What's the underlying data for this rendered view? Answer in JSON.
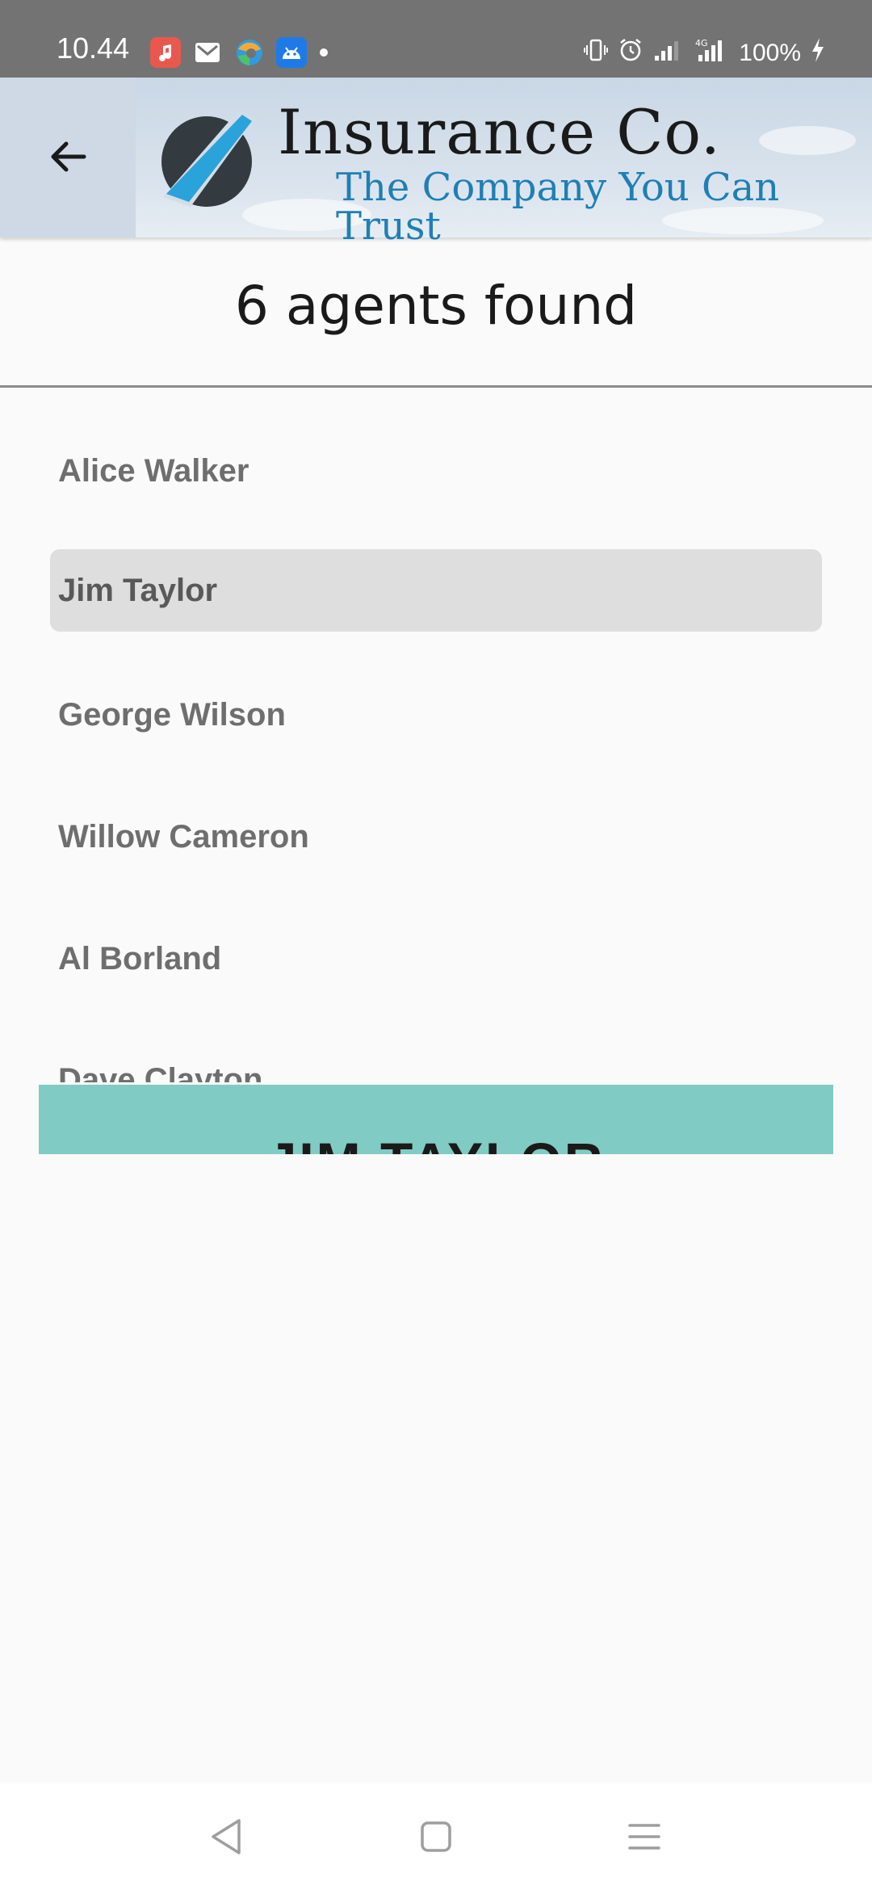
{
  "status_bar": {
    "time": "10.44",
    "battery": "100%",
    "network": "4G",
    "app_icons": [
      "music-icon",
      "mail-icon",
      "browser-icon",
      "android-icon"
    ]
  },
  "header": {
    "brand_name": "Insurance Co.",
    "tagline": "The Company You Can Trust",
    "colors": {
      "tagline": "#1f7fb5",
      "logo_dark": "#333b40",
      "logo_accent": "#2aa3da"
    }
  },
  "results": {
    "count_text": "6 agents found"
  },
  "agents": [
    {
      "name": "Alice Walker",
      "selected": false
    },
    {
      "name": "Jim Taylor",
      "selected": true
    },
    {
      "name": "George Wilson",
      "selected": false
    },
    {
      "name": "Willow Cameron",
      "selected": false
    },
    {
      "name": "Al Borland",
      "selected": false
    },
    {
      "name": "Dave Clayton",
      "selected": false
    }
  ],
  "selection_bar": {
    "label": "JIM TAYLOR",
    "color": "#80cbc4"
  },
  "nav_bar": {
    "buttons": [
      "back-nav-icon",
      "home-nav-icon",
      "menu-nav-icon"
    ]
  }
}
